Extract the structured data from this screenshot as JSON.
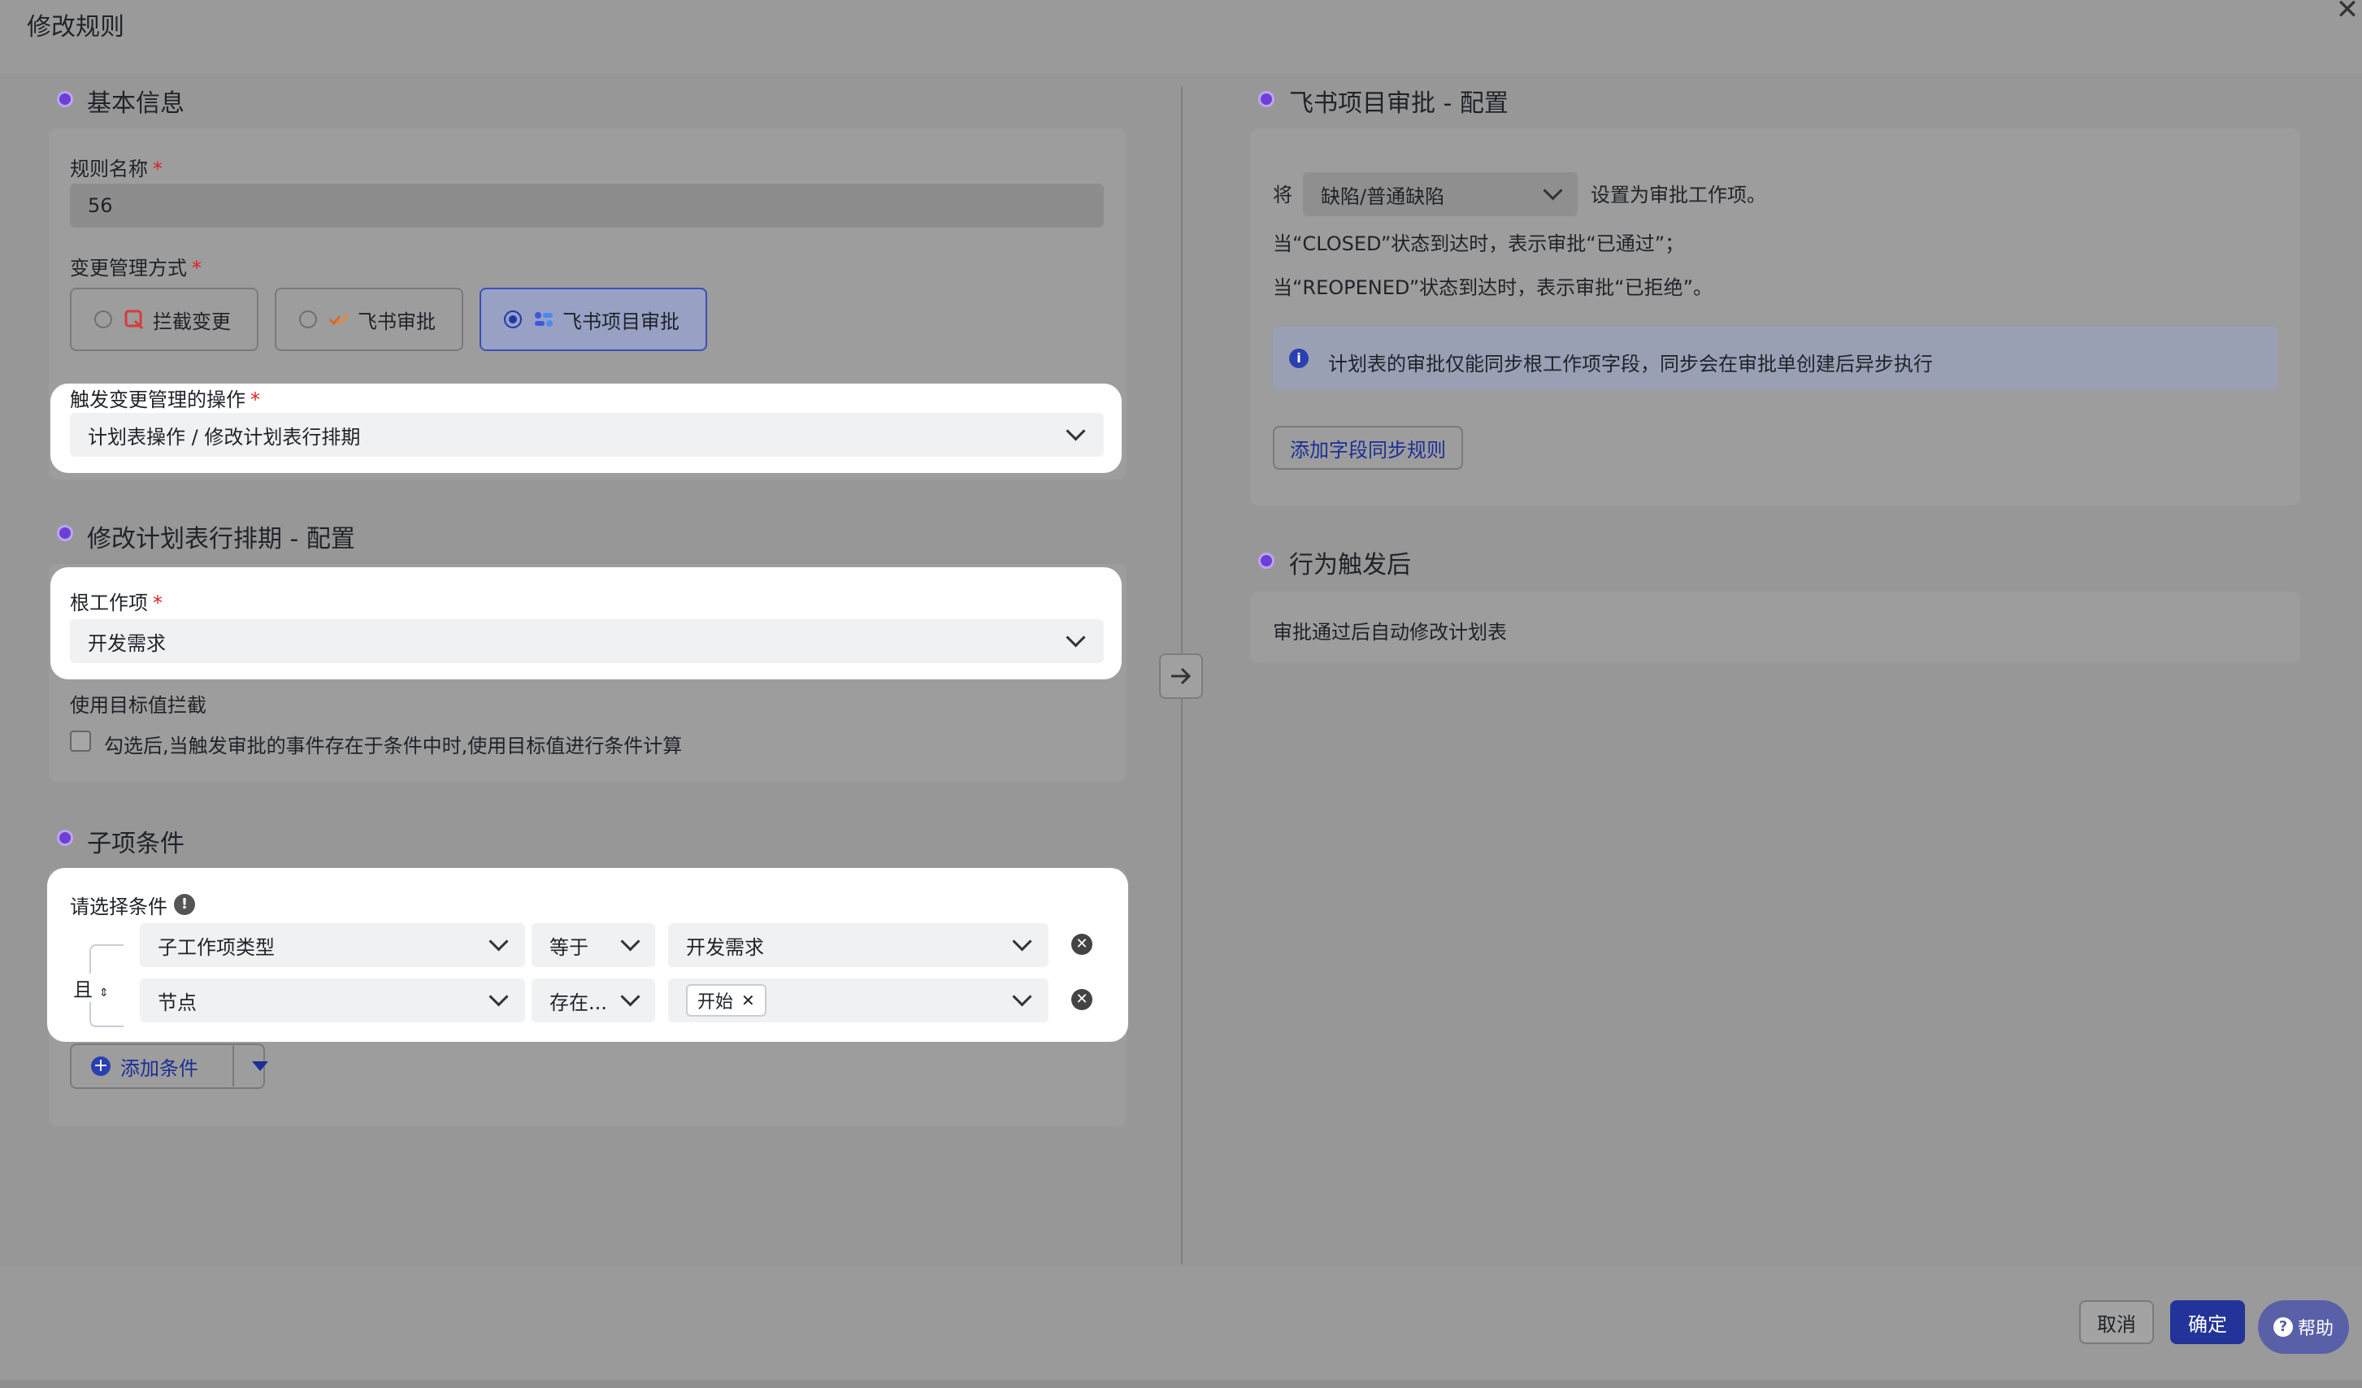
{
  "dialog": {
    "title": "修改规则"
  },
  "left": {
    "basic": {
      "title": "基本信息",
      "rule_name_label": "规则名称",
      "rule_name_value": "56",
      "change_mgmt_label": "变更管理方式",
      "options": [
        "拦截变更",
        "飞书审批",
        "飞书项目审批"
      ],
      "selected_option": "飞书项目审批",
      "trigger_label": "触发变更管理的操作",
      "trigger_value": "计划表操作 / 修改计划表行排期"
    },
    "config": {
      "title": "修改计划表行排期 - 配置",
      "root_label": "根工作项",
      "root_value": "开发需求",
      "target_label": "使用目标值拦截",
      "target_checkbox_text": "勾选后,当触发审批的事件存在于条件中时,使用目标值进行条件计算"
    },
    "sub": {
      "title": "子项条件",
      "select_label": "请选择条件",
      "logic": "且",
      "rows": [
        {
          "field": "子工作项类型",
          "op": "等于",
          "value": "开发需求"
        },
        {
          "field": "节点",
          "op": "存在...",
          "tag": "开始"
        }
      ],
      "add_label": "添加条件"
    }
  },
  "right": {
    "approval": {
      "title": "飞书项目审批 - 配置",
      "prefix": "将",
      "select_value": "缺陷/普通缺陷",
      "suffix": "设置为审批工作项。",
      "line1": "当“CLOSED”状态到达时，表示审批“已通过”；",
      "line2": "当“REOPENED”状态到达时，表示审批“已拒绝”。",
      "info": "计划表的审批仅能同步根工作项字段，同步会在审批单创建后异步执行",
      "add_sync_label": "添加字段同步规则"
    },
    "after": {
      "title": "行为触发后",
      "text": "审批通过后自动修改计划表"
    }
  },
  "footer": {
    "cancel": "取消",
    "ok": "确定",
    "help": "帮助"
  },
  "colors": {
    "accent": "#2a3fb0",
    "dot": "#6d3fd6",
    "danger": "#e02020"
  }
}
